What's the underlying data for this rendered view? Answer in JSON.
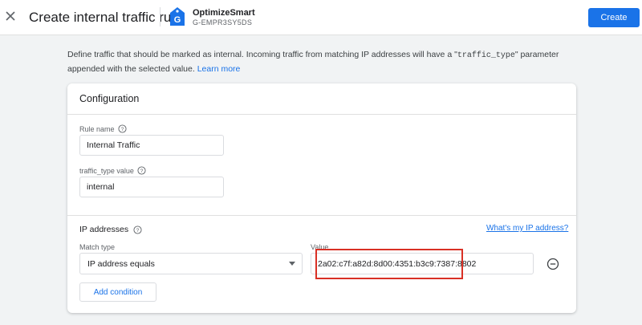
{
  "header": {
    "title": "Create internal traffic rule",
    "property_name": "OptimizeSmart",
    "property_id": "G-EMPR3SY5DS",
    "create_label": "Create",
    "icon_letter": "G"
  },
  "intro": {
    "text_before": "Define traffic that should be marked as internal. Incoming traffic from matching IP addresses will have a \"",
    "param": "traffic_type",
    "text_after": "\" parameter appended with the selected value. ",
    "link": "Learn more"
  },
  "configuration": {
    "title": "Configuration",
    "rule_name_label": "Rule name",
    "rule_name_value": "Internal Traffic",
    "traffic_type_label": "traffic_type value",
    "traffic_type_value": "internal"
  },
  "ip_addresses": {
    "title": "IP addresses",
    "whats_my_ip_link": "What's my IP address?",
    "match_type_label": "Match type",
    "match_type_value": "IP address equals",
    "value_label": "Value",
    "value": "2a02:c7f:a82d:8d00:4351:b3c9:7387:8802",
    "add_condition_label": "Add condition"
  },
  "colors": {
    "accent": "#1a73e8",
    "highlight": "#d93025",
    "background": "#f1f3f4"
  }
}
